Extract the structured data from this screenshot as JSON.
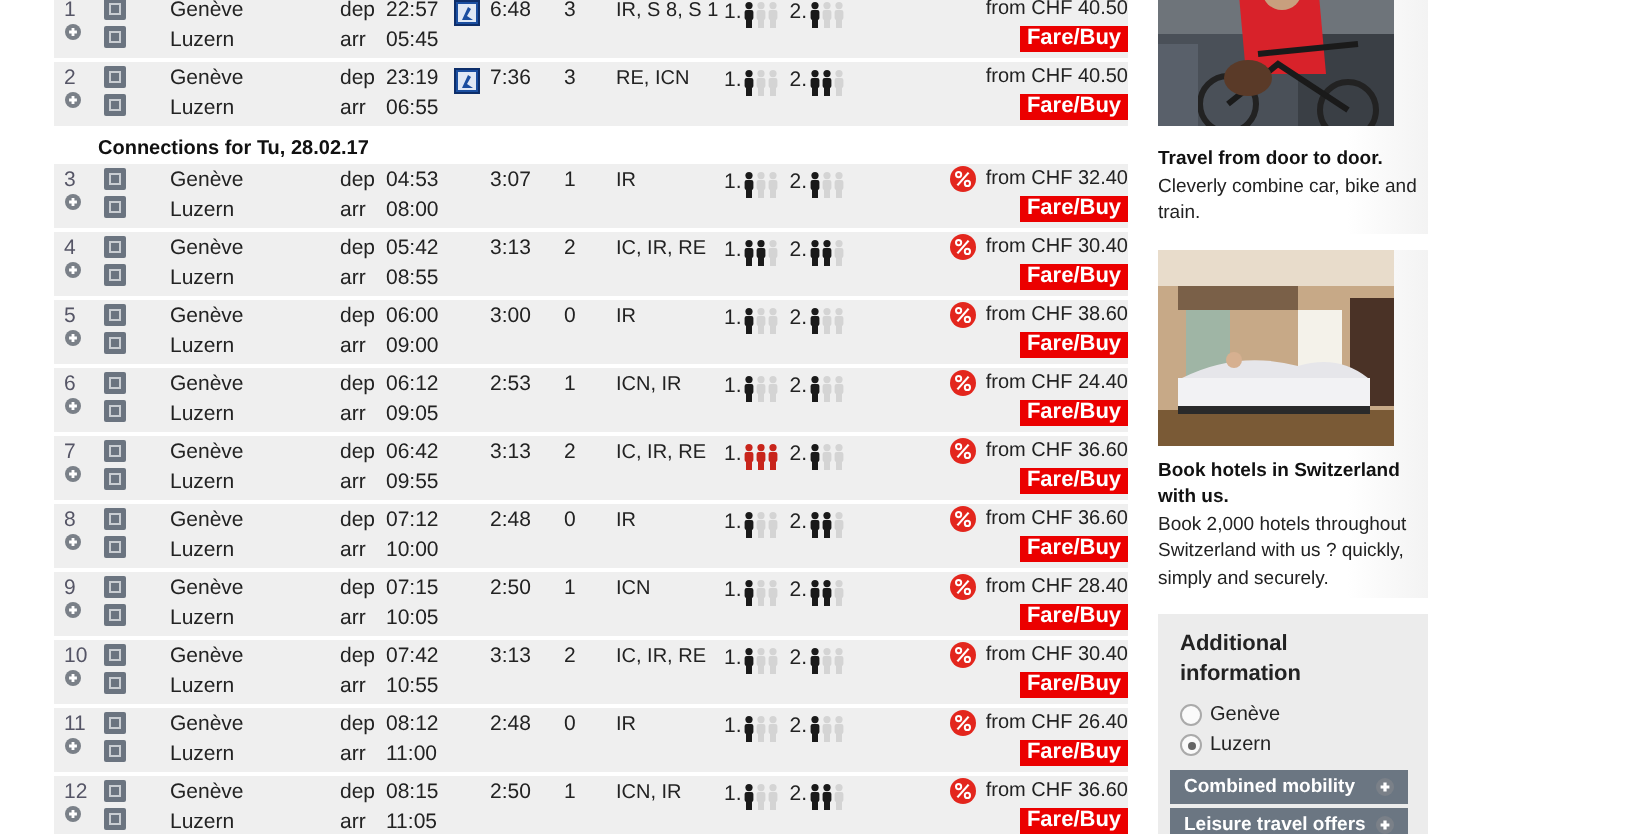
{
  "connections": [
    {
      "kind": "connection",
      "number": "1",
      "from": "Genève",
      "to": "Luzern",
      "dep_label": "dep",
      "dep": "22:57",
      "arr_label": "arr",
      "arr": "05:45",
      "night": true,
      "duration": "6:48",
      "changes": "3",
      "products": "IR, S 8, S 1",
      "class1": {
        "label": "1.",
        "figures": [
          {
            "on": true
          },
          {
            "on": false
          },
          {
            "on": false
          }
        ]
      },
      "class2": {
        "label": "2.",
        "figures": [
          {
            "on": true
          },
          {
            "on": false
          },
          {
            "on": false
          }
        ]
      },
      "discount": false,
      "price": "from CHF 40.50",
      "button": "Fare/Buy"
    },
    {
      "kind": "connection",
      "number": "2",
      "from": "Genève",
      "to": "Luzern",
      "dep_label": "dep",
      "dep": "23:19",
      "arr_label": "arr",
      "arr": "06:55",
      "night": true,
      "duration": "7:36",
      "changes": "3",
      "products": "RE, ICN",
      "class1": {
        "label": "1.",
        "figures": [
          {
            "on": true
          },
          {
            "on": false
          },
          {
            "on": false
          }
        ]
      },
      "class2": {
        "label": "2.",
        "figures": [
          {
            "on": true
          },
          {
            "on": true
          },
          {
            "on": false
          }
        ]
      },
      "discount": false,
      "price": "from CHF 40.50",
      "button": "Fare/Buy"
    },
    {
      "kind": "date",
      "text": "Connections for Tu, 28.02.17"
    },
    {
      "kind": "connection",
      "number": "3",
      "from": "Genève",
      "to": "Luzern",
      "dep_label": "dep",
      "dep": "04:53",
      "arr_label": "arr",
      "arr": "08:00",
      "night": false,
      "duration": "3:07",
      "changes": "1",
      "products": "IR",
      "class1": {
        "label": "1.",
        "figures": [
          {
            "on": true
          },
          {
            "on": false
          },
          {
            "on": false
          }
        ]
      },
      "class2": {
        "label": "2.",
        "figures": [
          {
            "on": true
          },
          {
            "on": false
          },
          {
            "on": false
          }
        ]
      },
      "discount": true,
      "price": "from CHF 32.40",
      "button": "Fare/Buy"
    },
    {
      "kind": "connection",
      "number": "4",
      "from": "Genève",
      "to": "Luzern",
      "dep_label": "dep",
      "dep": "05:42",
      "arr_label": "arr",
      "arr": "08:55",
      "night": false,
      "duration": "3:13",
      "changes": "2",
      "products": "IC, IR, RE",
      "class1": {
        "label": "1.",
        "figures": [
          {
            "on": true
          },
          {
            "on": true
          },
          {
            "on": false
          }
        ]
      },
      "class2": {
        "label": "2.",
        "figures": [
          {
            "on": true
          },
          {
            "on": true
          },
          {
            "on": false
          }
        ]
      },
      "discount": true,
      "price": "from CHF 30.40",
      "button": "Fare/Buy"
    },
    {
      "kind": "connection",
      "number": "5",
      "from": "Genève",
      "to": "Luzern",
      "dep_label": "dep",
      "dep": "06:00",
      "arr_label": "arr",
      "arr": "09:00",
      "night": false,
      "duration": "3:00",
      "changes": "0",
      "products": "IR",
      "class1": {
        "label": "1.",
        "figures": [
          {
            "on": true
          },
          {
            "on": false
          },
          {
            "on": false
          }
        ]
      },
      "class2": {
        "label": "2.",
        "figures": [
          {
            "on": true
          },
          {
            "on": false
          },
          {
            "on": false
          }
        ]
      },
      "discount": true,
      "price": "from CHF 38.60",
      "button": "Fare/Buy"
    },
    {
      "kind": "connection",
      "number": "6",
      "from": "Genève",
      "to": "Luzern",
      "dep_label": "dep",
      "dep": "06:12",
      "arr_label": "arr",
      "arr": "09:05",
      "night": false,
      "duration": "2:53",
      "changes": "1",
      "products": "ICN, IR",
      "class1": {
        "label": "1.",
        "figures": [
          {
            "on": true
          },
          {
            "on": false
          },
          {
            "on": false
          }
        ]
      },
      "class2": {
        "label": "2.",
        "figures": [
          {
            "on": true
          },
          {
            "on": false
          },
          {
            "on": false
          }
        ]
      },
      "discount": true,
      "price": "from CHF 24.40",
      "button": "Fare/Buy"
    },
    {
      "kind": "connection",
      "number": "7",
      "from": "Genève",
      "to": "Luzern",
      "dep_label": "dep",
      "dep": "06:42",
      "arr_label": "arr",
      "arr": "09:55",
      "night": false,
      "duration": "3:13",
      "changes": "2",
      "products": "IC, IR, RE",
      "class1": {
        "label": "1.",
        "figures": [
          {
            "on": true
          },
          {
            "on": true
          },
          {
            "on": true
          }
        ]
      },
      "class2": {
        "label": "2.",
        "figures": [
          {
            "on": true
          },
          {
            "on": false
          },
          {
            "on": false
          }
        ]
      },
      "discount": true,
      "price": "from CHF 36.60",
      "button": "Fare/Buy"
    },
    {
      "kind": "connection",
      "number": "8",
      "from": "Genève",
      "to": "Luzern",
      "dep_label": "dep",
      "dep": "07:12",
      "arr_label": "arr",
      "arr": "10:00",
      "night": false,
      "duration": "2:48",
      "changes": "0",
      "products": "IR",
      "class1": {
        "label": "1.",
        "figures": [
          {
            "on": true
          },
          {
            "on": false
          },
          {
            "on": false
          }
        ]
      },
      "class2": {
        "label": "2.",
        "figures": [
          {
            "on": true
          },
          {
            "on": true
          },
          {
            "on": false
          }
        ]
      },
      "discount": true,
      "price": "from CHF 36.60",
      "button": "Fare/Buy"
    },
    {
      "kind": "connection",
      "number": "9",
      "from": "Genève",
      "to": "Luzern",
      "dep_label": "dep",
      "dep": "07:15",
      "arr_label": "arr",
      "arr": "10:05",
      "night": false,
      "duration": "2:50",
      "changes": "1",
      "products": "ICN",
      "class1": {
        "label": "1.",
        "figures": [
          {
            "on": true
          },
          {
            "on": false
          },
          {
            "on": false
          }
        ]
      },
      "class2": {
        "label": "2.",
        "figures": [
          {
            "on": true
          },
          {
            "on": true
          },
          {
            "on": false
          }
        ]
      },
      "discount": true,
      "price": "from CHF 28.40",
      "button": "Fare/Buy"
    },
    {
      "kind": "connection",
      "number": "10",
      "from": "Genève",
      "to": "Luzern",
      "dep_label": "dep",
      "dep": "07:42",
      "arr_label": "arr",
      "arr": "10:55",
      "night": false,
      "duration": "3:13",
      "changes": "2",
      "products": "IC, IR, RE",
      "class1": {
        "label": "1.",
        "figures": [
          {
            "on": true
          },
          {
            "on": false
          },
          {
            "on": false
          }
        ]
      },
      "class2": {
        "label": "2.",
        "figures": [
          {
            "on": true
          },
          {
            "on": false
          },
          {
            "on": false
          }
        ]
      },
      "discount": true,
      "price": "from CHF 30.40",
      "button": "Fare/Buy"
    },
    {
      "kind": "connection",
      "number": "11",
      "from": "Genève",
      "to": "Luzern",
      "dep_label": "dep",
      "dep": "08:12",
      "arr_label": "arr",
      "arr": "11:00",
      "night": false,
      "duration": "2:48",
      "changes": "0",
      "products": "IR",
      "class1": {
        "label": "1.",
        "figures": [
          {
            "on": true
          },
          {
            "on": false
          },
          {
            "on": false
          }
        ]
      },
      "class2": {
        "label": "2.",
        "figures": [
          {
            "on": true
          },
          {
            "on": false
          },
          {
            "on": false
          }
        ]
      },
      "discount": true,
      "price": "from CHF 26.40",
      "button": "Fare/Buy"
    },
    {
      "kind": "connection",
      "number": "12",
      "from": "Genève",
      "to": "Luzern",
      "dep_label": "dep",
      "dep": "08:15",
      "arr_label": "arr",
      "arr": "11:05",
      "night": false,
      "duration": "2:50",
      "changes": "1",
      "products": "ICN, IR",
      "class1": {
        "label": "1.",
        "figures": [
          {
            "on": true
          },
          {
            "on": false
          },
          {
            "on": false
          }
        ]
      },
      "class2": {
        "label": "2.",
        "figures": [
          {
            "on": true
          },
          {
            "on": true
          },
          {
            "on": false
          }
        ]
      },
      "discount": true,
      "price": "from CHF 36.60",
      "button": "Fare/Buy"
    }
  ],
  "teasers": [
    {
      "kind": "bike",
      "title": "Travel from door to door.",
      "text": "Cleverly combine car, bike and train."
    },
    {
      "kind": "hotel",
      "title": "Book hotels in Switzerland with us.",
      "text": "Book 2,000 hotels throughout Switzerland with us ? quickly, simply and securely."
    }
  ],
  "info": {
    "title": "Additional information",
    "stations": [
      {
        "label": "Genève",
        "selected": false
      },
      {
        "label": "Luzern",
        "selected": true
      }
    ],
    "buttons": [
      "Combined mobility",
      "Leisure travel offers"
    ]
  }
}
